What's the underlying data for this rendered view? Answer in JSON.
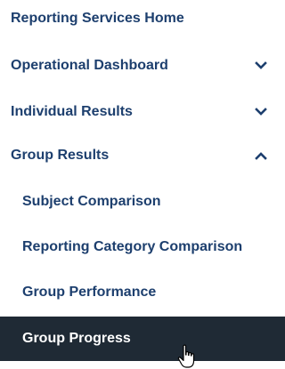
{
  "nav": {
    "items": [
      {
        "label": "Reporting Services Home",
        "level": "top",
        "chevron": null
      },
      {
        "label": "Operational Dashboard",
        "level": "top",
        "chevron": "chevron-down"
      },
      {
        "label": "Individual Results",
        "level": "top",
        "chevron": "chevron-down"
      },
      {
        "label": "Group Results",
        "level": "top",
        "chevron": "chevron-up",
        "expanded": true
      },
      {
        "label": "Subject Comparison",
        "level": "sub",
        "chevron": null
      },
      {
        "label": "Reporting Category Comparison",
        "level": "sub",
        "chevron": null
      },
      {
        "label": "Group Performance",
        "level": "sub",
        "chevron": null
      },
      {
        "label": "Group Progress",
        "level": "sub",
        "chevron": null,
        "active": true
      }
    ]
  },
  "colors": {
    "link": "#1d3f6e",
    "active_bg": "#1f2a35",
    "active_text": "#ffffff"
  },
  "icons": {
    "cursor": "hand-pointer-icon"
  }
}
